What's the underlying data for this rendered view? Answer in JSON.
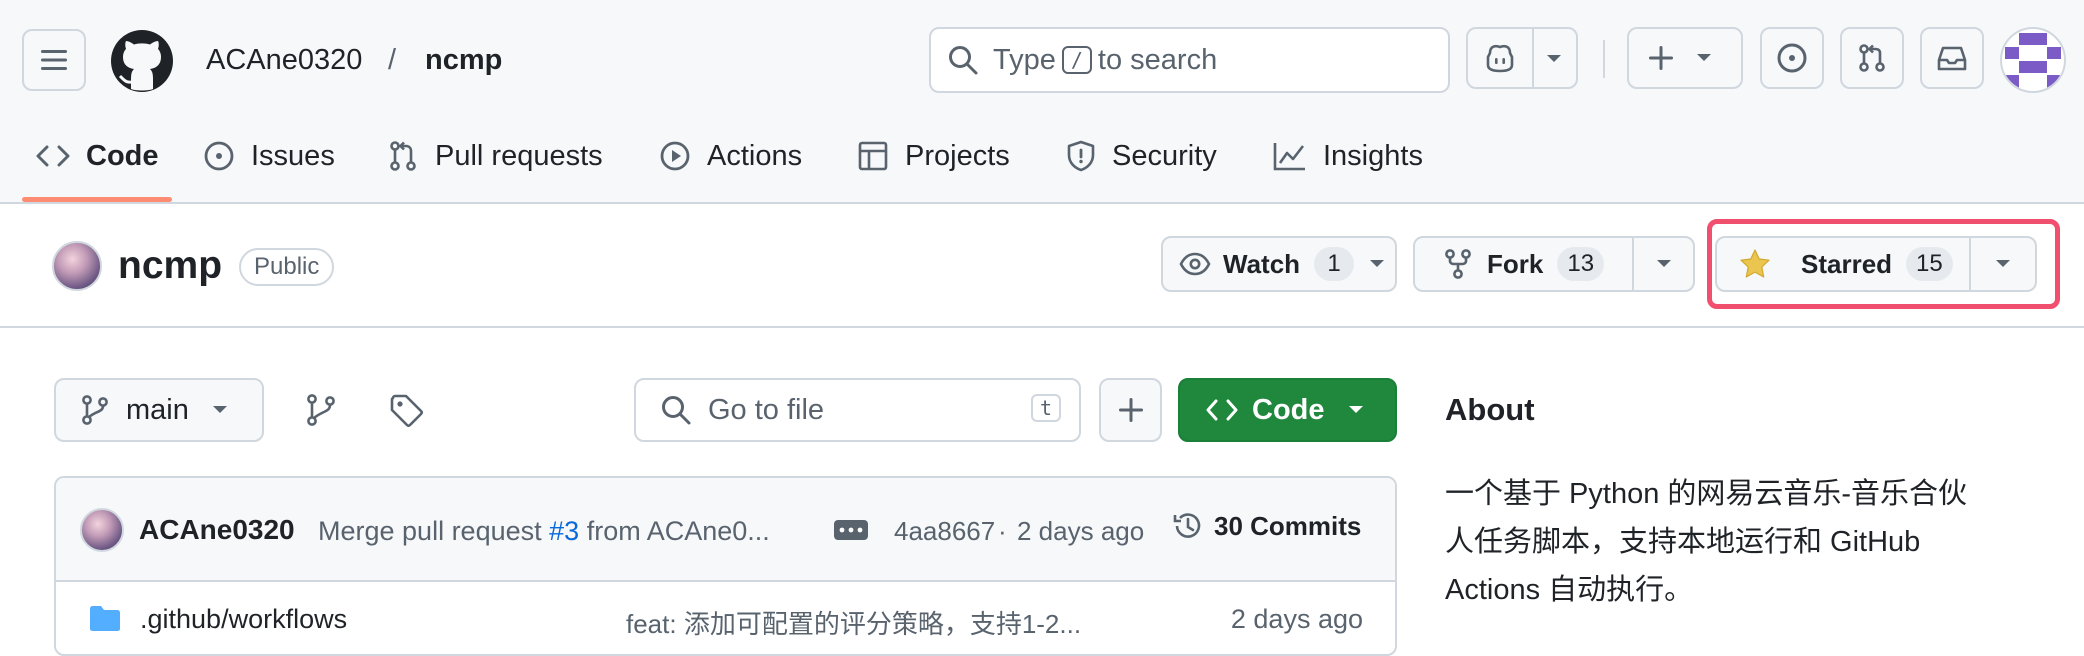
{
  "header": {
    "owner": "ACAne0320",
    "separator": "/",
    "repo": "ncmp",
    "search_prefix": "Type",
    "search_key": "/",
    "search_suffix": "to search"
  },
  "nav": {
    "tabs": [
      {
        "label": "Code",
        "icon": "code-icon",
        "selected": true
      },
      {
        "label": "Issues",
        "icon": "issue-opened-icon"
      },
      {
        "label": "Pull requests",
        "icon": "git-pull-request-icon"
      },
      {
        "label": "Actions",
        "icon": "play-icon"
      },
      {
        "label": "Projects",
        "icon": "table-icon"
      },
      {
        "label": "Security",
        "icon": "shield-icon"
      },
      {
        "label": "Insights",
        "icon": "graph-icon"
      }
    ]
  },
  "repo_title": {
    "name": "ncmp",
    "visibility": "Public",
    "watch_label": "Watch",
    "watch_count": "1",
    "fork_label": "Fork",
    "fork_count": "13",
    "star_label": "Starred",
    "star_count": "15"
  },
  "toolbar": {
    "branch": "main",
    "go_to_file_placeholder": "Go to file",
    "go_to_file_key": "t",
    "code_button": "Code"
  },
  "latest_commit": {
    "author": "ACAne0320",
    "message_prefix": "Merge pull request",
    "pr_link": "#3",
    "message_suffix": "from ACAne0...",
    "sha": "4aa8667",
    "dot": "·",
    "time": "2 days ago",
    "commits_label": "30 Commits"
  },
  "files": [
    {
      "name": ".github/workflows",
      "message": "feat: 添加可配置的评分策略，支持1-2...",
      "time": "2 days ago"
    }
  ],
  "about": {
    "heading": "About",
    "description_lines": [
      "一个基于 Python 的网易云音乐-音乐合伙",
      "人任务脚本，支持本地运行和 GitHub",
      "Actions 自动执行。"
    ]
  },
  "colors": {
    "accent_link": "#0969da",
    "code_button_green": "#1f883d",
    "tab_underline": "#fd8c73",
    "highlight_box": "#f0506e",
    "star_yellow": "#eac54f"
  }
}
